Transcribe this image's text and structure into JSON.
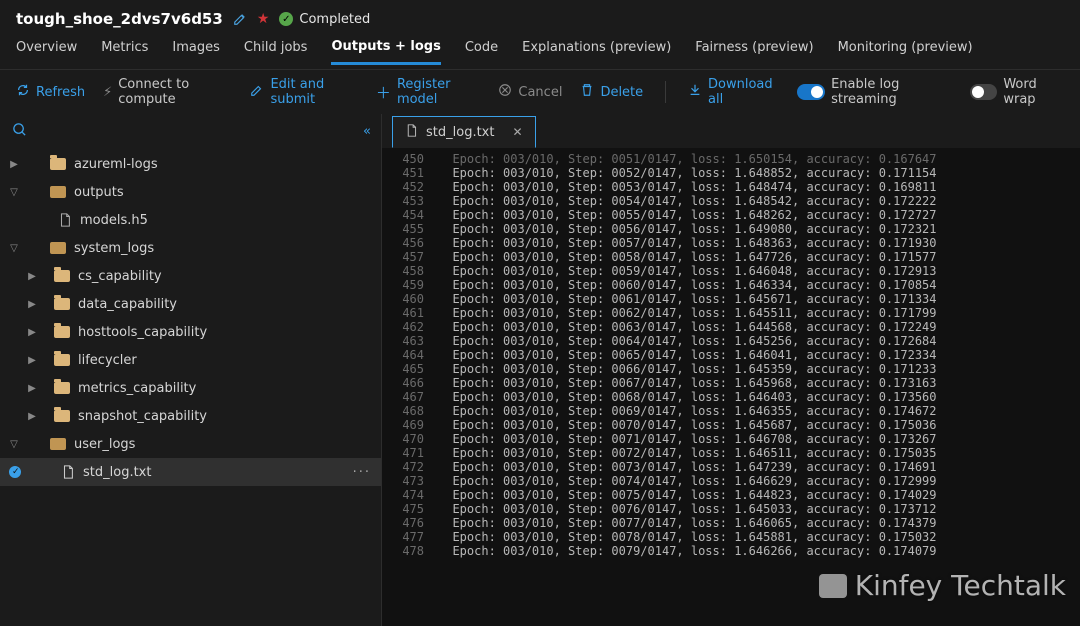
{
  "header": {
    "job_name": "tough_shoe_2dvs7v6d53",
    "status_label": "Completed"
  },
  "tabs": {
    "overview": "Overview",
    "metrics": "Metrics",
    "images": "Images",
    "child_jobs": "Child jobs",
    "outputs_logs": "Outputs + logs",
    "code": "Code",
    "explanations": "Explanations (preview)",
    "fairness": "Fairness (preview)",
    "monitoring": "Monitoring (preview)"
  },
  "toolbar": {
    "refresh": "Refresh",
    "connect": "Connect to compute",
    "edit_submit": "Edit and submit",
    "register_model": "Register model",
    "cancel": "Cancel",
    "delete": "Delete",
    "download_all": "Download all",
    "enable_log_streaming": "Enable log streaming",
    "word_wrap": "Word wrap"
  },
  "search": {
    "placeholder": ""
  },
  "tree": {
    "azureml_logs": "azureml-logs",
    "outputs": "outputs",
    "models_h5": "models.h5",
    "system_logs": "system_logs",
    "cs_capability": "cs_capability",
    "data_capability": "data_capability",
    "hosttools_capability": "hosttools_capability",
    "lifecycler": "lifecycler",
    "metrics_capability": "metrics_capability",
    "snapshot_capability": "snapshot_capability",
    "user_logs": "user_logs",
    "std_log": "std_log.txt"
  },
  "file_tab": {
    "name": "std_log.txt"
  },
  "log_lines": [
    {
      "n": 450,
      "text": "Epoch: 003/010, Step: 0051/0147, loss: 1.650154, accuracy: 0.167647",
      "dim": true
    },
    {
      "n": 451,
      "text": "Epoch: 003/010, Step: 0052/0147, loss: 1.648852, accuracy: 0.171154"
    },
    {
      "n": 452,
      "text": "Epoch: 003/010, Step: 0053/0147, loss: 1.648474, accuracy: 0.169811"
    },
    {
      "n": 453,
      "text": "Epoch: 003/010, Step: 0054/0147, loss: 1.648542, accuracy: 0.172222"
    },
    {
      "n": 454,
      "text": "Epoch: 003/010, Step: 0055/0147, loss: 1.648262, accuracy: 0.172727"
    },
    {
      "n": 455,
      "text": "Epoch: 003/010, Step: 0056/0147, loss: 1.649080, accuracy: 0.172321"
    },
    {
      "n": 456,
      "text": "Epoch: 003/010, Step: 0057/0147, loss: 1.648363, accuracy: 0.171930"
    },
    {
      "n": 457,
      "text": "Epoch: 003/010, Step: 0058/0147, loss: 1.647726, accuracy: 0.171577"
    },
    {
      "n": 458,
      "text": "Epoch: 003/010, Step: 0059/0147, loss: 1.646048, accuracy: 0.172913"
    },
    {
      "n": 459,
      "text": "Epoch: 003/010, Step: 0060/0147, loss: 1.646334, accuracy: 0.170854"
    },
    {
      "n": 460,
      "text": "Epoch: 003/010, Step: 0061/0147, loss: 1.645671, accuracy: 0.171334"
    },
    {
      "n": 461,
      "text": "Epoch: 003/010, Step: 0062/0147, loss: 1.645511, accuracy: 0.171799"
    },
    {
      "n": 462,
      "text": "Epoch: 003/010, Step: 0063/0147, loss: 1.644568, accuracy: 0.172249"
    },
    {
      "n": 463,
      "text": "Epoch: 003/010, Step: 0064/0147, loss: 1.645256, accuracy: 0.172684"
    },
    {
      "n": 464,
      "text": "Epoch: 003/010, Step: 0065/0147, loss: 1.646041, accuracy: 0.172334"
    },
    {
      "n": 465,
      "text": "Epoch: 003/010, Step: 0066/0147, loss: 1.645359, accuracy: 0.171233"
    },
    {
      "n": 466,
      "text": "Epoch: 003/010, Step: 0067/0147, loss: 1.645968, accuracy: 0.173163"
    },
    {
      "n": 467,
      "text": "Epoch: 003/010, Step: 0068/0147, loss: 1.646403, accuracy: 0.173560"
    },
    {
      "n": 468,
      "text": "Epoch: 003/010, Step: 0069/0147, loss: 1.646355, accuracy: 0.174672"
    },
    {
      "n": 469,
      "text": "Epoch: 003/010, Step: 0070/0147, loss: 1.645687, accuracy: 0.175036"
    },
    {
      "n": 470,
      "text": "Epoch: 003/010, Step: 0071/0147, loss: 1.646708, accuracy: 0.173267"
    },
    {
      "n": 471,
      "text": "Epoch: 003/010, Step: 0072/0147, loss: 1.646511, accuracy: 0.175035"
    },
    {
      "n": 472,
      "text": "Epoch: 003/010, Step: 0073/0147, loss: 1.647239, accuracy: 0.174691"
    },
    {
      "n": 473,
      "text": "Epoch: 003/010, Step: 0074/0147, loss: 1.646629, accuracy: 0.172999"
    },
    {
      "n": 474,
      "text": "Epoch: 003/010, Step: 0075/0147, loss: 1.644823, accuracy: 0.174029"
    },
    {
      "n": 475,
      "text": "Epoch: 003/010, Step: 0076/0147, loss: 1.645033, accuracy: 0.173712"
    },
    {
      "n": 476,
      "text": "Epoch: 003/010, Step: 0077/0147, loss: 1.646065, accuracy: 0.174379"
    },
    {
      "n": 477,
      "text": "Epoch: 003/010, Step: 0078/0147, loss: 1.645881, accuracy: 0.175032"
    },
    {
      "n": 478,
      "text": "Epoch: 003/010, Step: 0079/0147, loss: 1.646266, accuracy: 0.174079"
    }
  ],
  "watermark": "Kinfey Techtalk"
}
